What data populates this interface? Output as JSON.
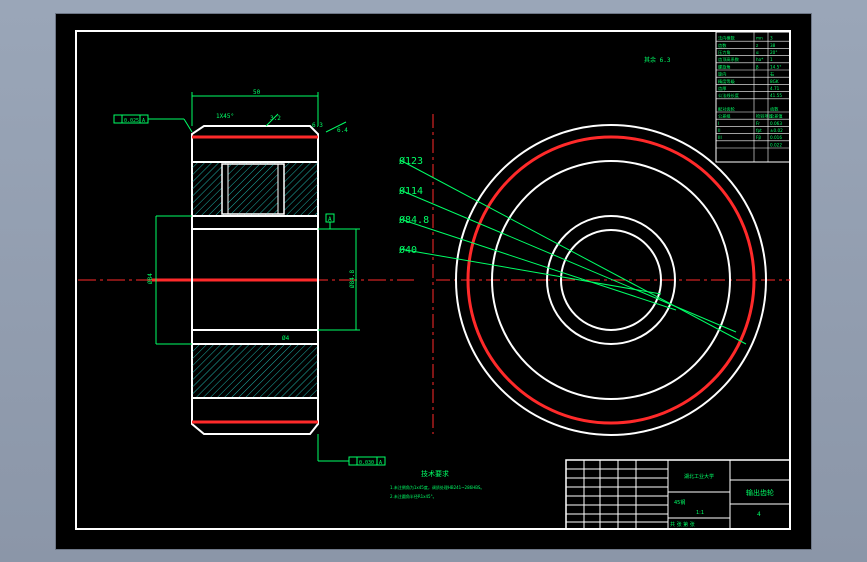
{
  "drawing": {
    "dimensions": {
      "face_width": "50",
      "chamfer_outer": "1X45°",
      "roughness_face": "3.2",
      "roughness_side": "6.3",
      "roughness_right": "6.4",
      "bore_dia": "Ø40",
      "hub_dia": "Ø84.8",
      "total_dia": "Ø123",
      "hole_label": "Ø84",
      "inner_len": "Ø4"
    },
    "leaders": {
      "d1": "Ø123",
      "d2": "Ø114",
      "d3": "Ø84.8",
      "d4": "Ø40"
    },
    "tolerances": {
      "top": "0.025",
      "top_ref": "A",
      "bottom": "0.030",
      "bottom_ref": "A",
      "datum": "A"
    },
    "top_right_note": "其余 6.3",
    "tech_requirements": {
      "title": "技术要求",
      "line1": "1.未注倒角为1x45度，调质处理HB241~286HBS。",
      "line2": "2.未注圆角半径R1x45°。"
    },
    "param_table": {
      "rows": [
        [
          "法向模数",
          "mn",
          "3"
        ],
        [
          "齿数",
          "z",
          "38"
        ],
        [
          "压力角",
          "α",
          "20°"
        ],
        [
          "齿顶高系数",
          "ha*",
          "1"
        ],
        [
          "螺旋角",
          "β",
          "14.5°"
        ],
        [
          "旋向",
          "",
          "右"
        ],
        [
          "精度等级",
          "",
          "8GK"
        ],
        [
          "齿厚",
          "",
          "4.71"
        ],
        [
          "公法线长度",
          "",
          "41.55"
        ]
      ],
      "rows2": [
        [
          "配对齿轮",
          "",
          "齿数"
        ],
        [
          "公差组",
          "检验项目",
          "公差值"
        ],
        [
          "I",
          "Fr",
          "0.063"
        ],
        [
          "II",
          "fpt",
          "±0.02"
        ],
        [
          "III",
          "Fβ",
          "0.016"
        ],
        [
          "",
          "",
          "0.022"
        ]
      ]
    },
    "title_block": {
      "school": "湖北工业大学",
      "part_name": "输出齿轮",
      "drawing_no": "4",
      "scale": "1:1",
      "material": "45钢",
      "sheet": "共 张 第 张"
    }
  }
}
